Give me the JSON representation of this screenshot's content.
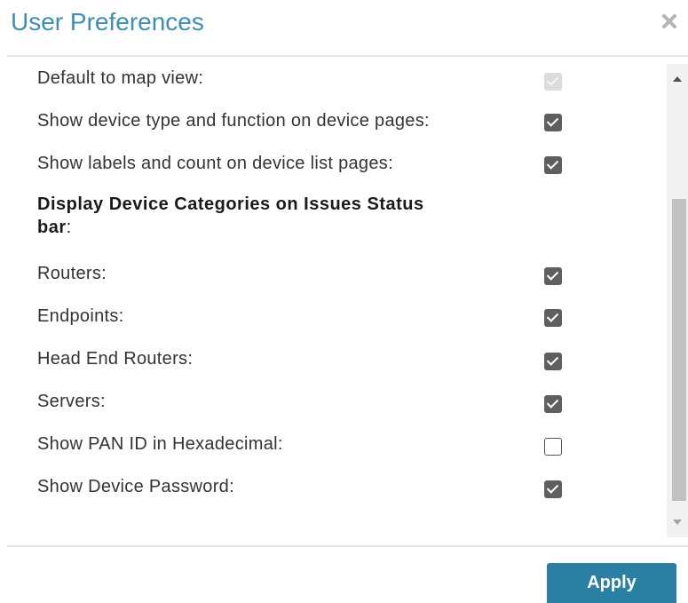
{
  "dialog": {
    "title": "User Preferences",
    "close_icon": "close-icon"
  },
  "preferences": [
    {
      "label": "Default to map view:",
      "state": "disabled-checked"
    },
    {
      "label": "Show device type and function on device pages:",
      "state": "checked"
    },
    {
      "label": "Show labels and count on device list pages:",
      "state": "checked"
    }
  ],
  "section": {
    "heading_line1": "Display Device Categories on Issues Status",
    "heading_line2": "bar",
    "heading_suffix": ":"
  },
  "categories": [
    {
      "label": "Routers:",
      "state": "checked"
    },
    {
      "label": "Endpoints:",
      "state": "checked"
    },
    {
      "label": "Head End Routers:",
      "state": "checked"
    },
    {
      "label": "Servers:",
      "state": "checked"
    },
    {
      "label": "Show PAN ID in Hexadecimal:",
      "state": "unchecked"
    },
    {
      "label": "Show Device Password:",
      "state": "checked"
    }
  ],
  "footer": {
    "apply_label": "Apply"
  },
  "colors": {
    "title": "#3e8fb0",
    "apply_button": "#2a7fa3",
    "checkbox_checked": "#5f5f5f"
  }
}
